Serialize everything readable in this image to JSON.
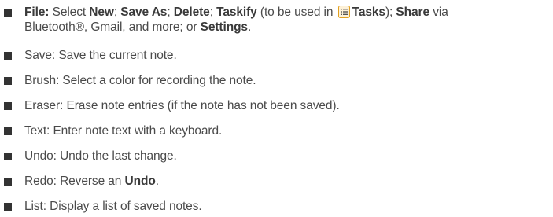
{
  "bullets": [
    {
      "parts": {
        "file_label": "File:",
        "select": " Select ",
        "new": "New",
        "sep1": "; ",
        "save_as": "Save As",
        "sep2": "; ",
        "delete": "Delete",
        "sep3": "; ",
        "taskify": "Taskify",
        "paren_open": " (to be used in ",
        "tasks_icon": "tasks-app-icon",
        "tasks": "Tasks",
        "paren_close": "); ",
        "share": "Share",
        "via": " via",
        "line2": "Bluetooth®, Gmail, and more; or ",
        "settings": "Settings",
        "period": "."
      }
    },
    {
      "text": "Save: Save the current note."
    },
    {
      "text": "Brush: Select a color for recording the note."
    },
    {
      "text": "Eraser: Erase note entries (if the note has not been saved)."
    },
    {
      "text": "Text: Enter note text with a keyboard."
    },
    {
      "text": "Undo: Undo the last change."
    },
    {
      "parts": {
        "lead": "Redo: Reverse an ",
        "undo": "Undo",
        "period": "."
      }
    },
    {
      "text": "List: Display a list of saved notes."
    }
  ],
  "colors": {
    "text": "#4a4a4a",
    "bullet": "#333333",
    "icon_accent": "#e2a020"
  }
}
